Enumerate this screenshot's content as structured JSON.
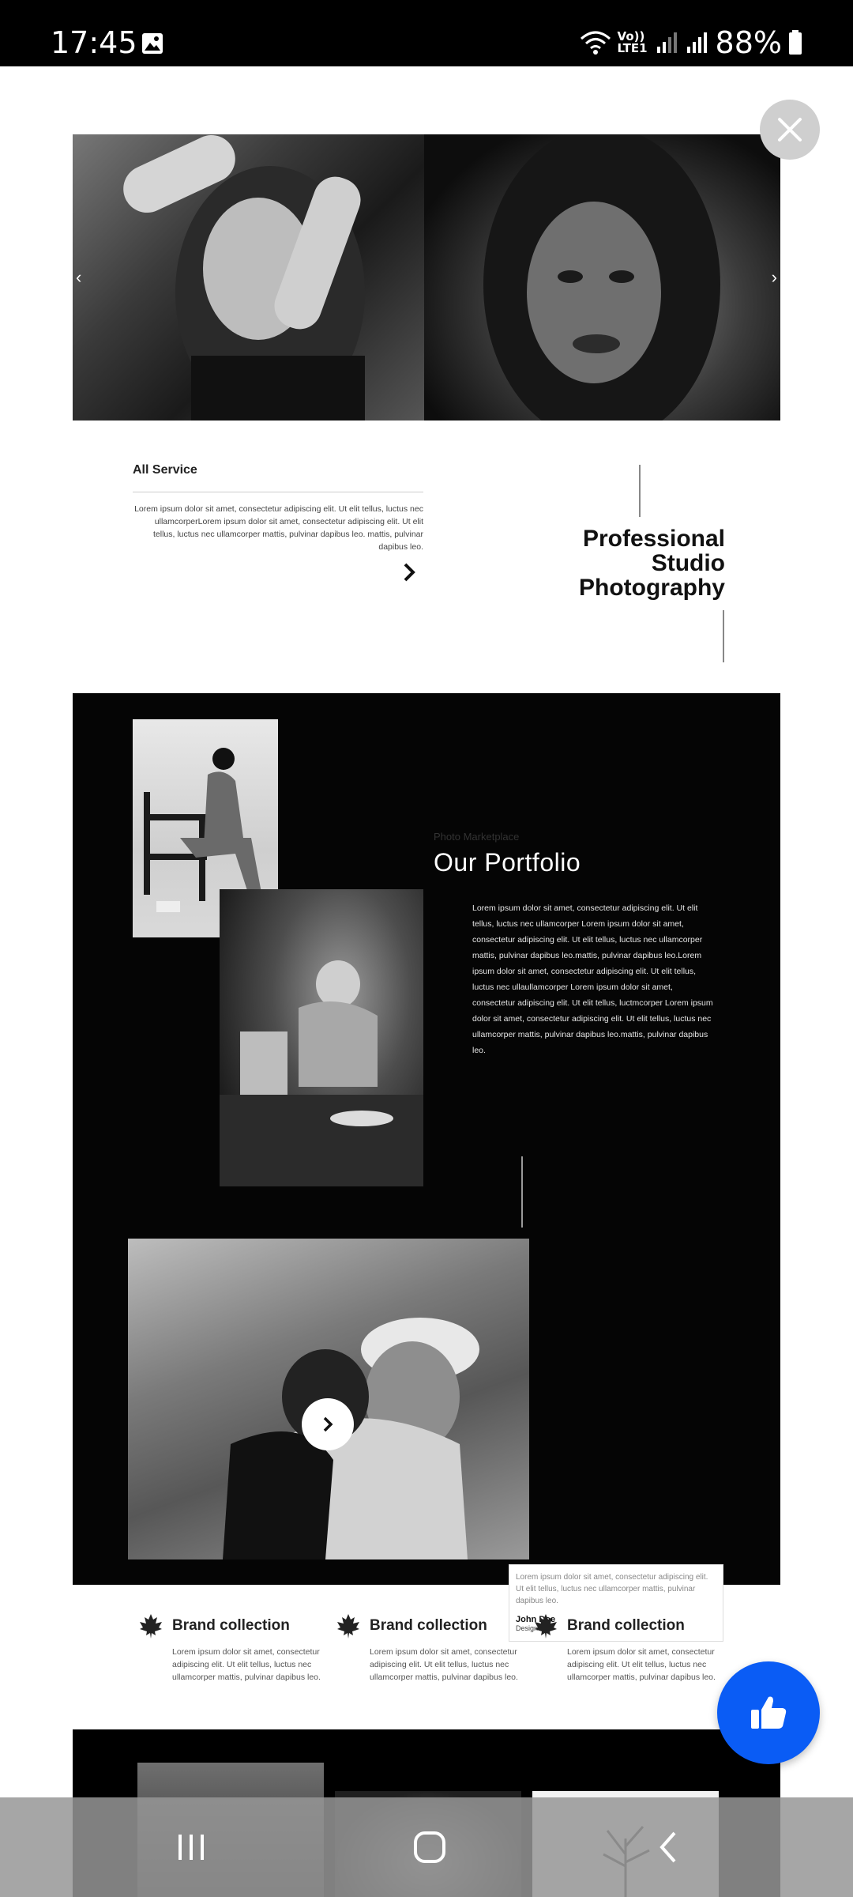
{
  "status_bar": {
    "time": "17:45",
    "network_label": "Vo)) LTE1",
    "battery": "88%"
  },
  "hero": {
    "prev_glyph": "‹",
    "next_glyph": "›"
  },
  "service": {
    "title": "All Service",
    "body": "Lorem ipsum dolor sit amet, consectetur adipiscing elit. Ut elit tellus, luctus nec ullamcorperLorem ipsum dolor sit amet, consectetur adipiscing elit. Ut elit tellus, luctus nec ullamcorper mattis, pulvinar dapibus leo. mattis, pulvinar dapibus leo."
  },
  "pro": {
    "line1": "Professional",
    "line2": "Studio",
    "line3": "Photography"
  },
  "portfolio": {
    "kicker": "Photo Marketplace",
    "title": "Our Portfolio",
    "body": "Lorem ipsum dolor sit amet, consectetur adipiscing elit. Ut elit tellus, luctus nec ullamcorper Lorem ipsum dolor sit amet, consectetur adipiscing elit. Ut elit tellus, luctus nec ullamcorper mattis, pulvinar dapibus leo.mattis, pulvinar dapibus leo.Lorem ipsum dolor sit amet, consectetur adipiscing elit. Ut elit tellus, luctus nec ullaullamcorper Lorem ipsum dolor sit amet, consectetur adipiscing elit. Ut elit tellus, luctmcorper Lorem ipsum dolor sit amet, consectetur adipiscing elit. Ut elit tellus, luctus nec ullamcorper mattis, pulvinar dapibus leo.mattis, pulvinar dapibus leo."
  },
  "quote": {
    "text": "Lorem ipsum dolor sit amet, consectetur adipiscing elit. Ut elit tellus, luctus nec ullamcorper mattis, pulvinar dapibus leo.",
    "name": "John Doe",
    "role": "Designer"
  },
  "brands": [
    {
      "title": "Brand collection",
      "text": "Lorem ipsum dolor sit amet, consectetur adipiscing elit. Ut elit tellus, luctus nec ullamcorper mattis, pulvinar dapibus leo."
    },
    {
      "title": "Brand collection",
      "text": "Lorem ipsum dolor sit amet, consectetur adipiscing elit. Ut elit tellus, luctus nec ullamcorper mattis, pulvinar dapibus leo."
    },
    {
      "title": "Brand collection",
      "text": "Lorem ipsum dolor sit amet, consectetur adipiscing elit. Ut elit tellus, luctus nec ullamcorper mattis, pulvinar dapibus leo."
    }
  ],
  "icons": {
    "close": "close-icon",
    "like": "thumbs-up-icon",
    "brand": "maple-leaf-icon",
    "nav_recent": "recent-apps-icon",
    "nav_home": "home-icon",
    "nav_back": "back-icon"
  },
  "colors": {
    "like_fab": "#0a5cf5",
    "dark_section": "#050505",
    "status_bar": "#000000"
  }
}
